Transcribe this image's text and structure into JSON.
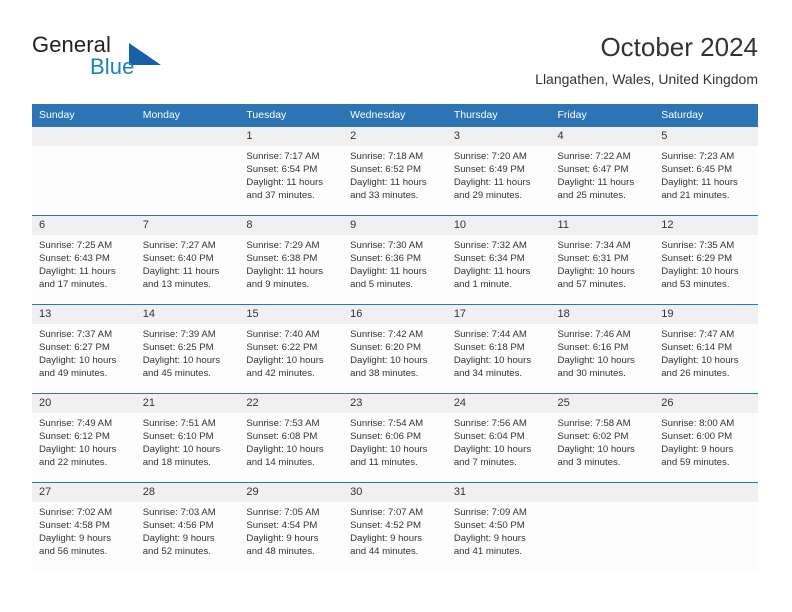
{
  "brand": {
    "name_top": "General",
    "name_bottom": "Blue",
    "logo_icon": "triangle-logo-icon",
    "color_top": "#231f20",
    "color_bottom": "#1d80c4",
    "color_triangle": "#1560a8"
  },
  "header": {
    "title": "October 2024",
    "location": "Llangathen, Wales, United Kingdom"
  },
  "theme": {
    "header_blue": "#2c74b3",
    "daynum_gray": "#f0f0f0",
    "text": "#333333"
  },
  "calendar": {
    "weekday_headers": [
      "Sunday",
      "Monday",
      "Tuesday",
      "Wednesday",
      "Thursday",
      "Friday",
      "Saturday"
    ],
    "weeks": [
      [
        {
          "day": "",
          "empty": true
        },
        {
          "day": "",
          "empty": true
        },
        {
          "day": "1",
          "sunrise": "Sunrise: 7:17 AM",
          "sunset": "Sunset: 6:54 PM",
          "daylight": "Daylight: 11 hours and 37 minutes."
        },
        {
          "day": "2",
          "sunrise": "Sunrise: 7:18 AM",
          "sunset": "Sunset: 6:52 PM",
          "daylight": "Daylight: 11 hours and 33 minutes."
        },
        {
          "day": "3",
          "sunrise": "Sunrise: 7:20 AM",
          "sunset": "Sunset: 6:49 PM",
          "daylight": "Daylight: 11 hours and 29 minutes."
        },
        {
          "day": "4",
          "sunrise": "Sunrise: 7:22 AM",
          "sunset": "Sunset: 6:47 PM",
          "daylight": "Daylight: 11 hours and 25 minutes."
        },
        {
          "day": "5",
          "sunrise": "Sunrise: 7:23 AM",
          "sunset": "Sunset: 6:45 PM",
          "daylight": "Daylight: 11 hours and 21 minutes."
        }
      ],
      [
        {
          "day": "6",
          "sunrise": "Sunrise: 7:25 AM",
          "sunset": "Sunset: 6:43 PM",
          "daylight": "Daylight: 11 hours and 17 minutes."
        },
        {
          "day": "7",
          "sunrise": "Sunrise: 7:27 AM",
          "sunset": "Sunset: 6:40 PM",
          "daylight": "Daylight: 11 hours and 13 minutes."
        },
        {
          "day": "8",
          "sunrise": "Sunrise: 7:29 AM",
          "sunset": "Sunset: 6:38 PM",
          "daylight": "Daylight: 11 hours and 9 minutes."
        },
        {
          "day": "9",
          "sunrise": "Sunrise: 7:30 AM",
          "sunset": "Sunset: 6:36 PM",
          "daylight": "Daylight: 11 hours and 5 minutes."
        },
        {
          "day": "10",
          "sunrise": "Sunrise: 7:32 AM",
          "sunset": "Sunset: 6:34 PM",
          "daylight": "Daylight: 11 hours and 1 minute."
        },
        {
          "day": "11",
          "sunrise": "Sunrise: 7:34 AM",
          "sunset": "Sunset: 6:31 PM",
          "daylight": "Daylight: 10 hours and 57 minutes."
        },
        {
          "day": "12",
          "sunrise": "Sunrise: 7:35 AM",
          "sunset": "Sunset: 6:29 PM",
          "daylight": "Daylight: 10 hours and 53 minutes."
        }
      ],
      [
        {
          "day": "13",
          "sunrise": "Sunrise: 7:37 AM",
          "sunset": "Sunset: 6:27 PM",
          "daylight": "Daylight: 10 hours and 49 minutes."
        },
        {
          "day": "14",
          "sunrise": "Sunrise: 7:39 AM",
          "sunset": "Sunset: 6:25 PM",
          "daylight": "Daylight: 10 hours and 45 minutes."
        },
        {
          "day": "15",
          "sunrise": "Sunrise: 7:40 AM",
          "sunset": "Sunset: 6:22 PM",
          "daylight": "Daylight: 10 hours and 42 minutes."
        },
        {
          "day": "16",
          "sunrise": "Sunrise: 7:42 AM",
          "sunset": "Sunset: 6:20 PM",
          "daylight": "Daylight: 10 hours and 38 minutes."
        },
        {
          "day": "17",
          "sunrise": "Sunrise: 7:44 AM",
          "sunset": "Sunset: 6:18 PM",
          "daylight": "Daylight: 10 hours and 34 minutes."
        },
        {
          "day": "18",
          "sunrise": "Sunrise: 7:46 AM",
          "sunset": "Sunset: 6:16 PM",
          "daylight": "Daylight: 10 hours and 30 minutes."
        },
        {
          "day": "19",
          "sunrise": "Sunrise: 7:47 AM",
          "sunset": "Sunset: 6:14 PM",
          "daylight": "Daylight: 10 hours and 26 minutes."
        }
      ],
      [
        {
          "day": "20",
          "sunrise": "Sunrise: 7:49 AM",
          "sunset": "Sunset: 6:12 PM",
          "daylight": "Daylight: 10 hours and 22 minutes."
        },
        {
          "day": "21",
          "sunrise": "Sunrise: 7:51 AM",
          "sunset": "Sunset: 6:10 PM",
          "daylight": "Daylight: 10 hours and 18 minutes."
        },
        {
          "day": "22",
          "sunrise": "Sunrise: 7:53 AM",
          "sunset": "Sunset: 6:08 PM",
          "daylight": "Daylight: 10 hours and 14 minutes."
        },
        {
          "day": "23",
          "sunrise": "Sunrise: 7:54 AM",
          "sunset": "Sunset: 6:06 PM",
          "daylight": "Daylight: 10 hours and 11 minutes."
        },
        {
          "day": "24",
          "sunrise": "Sunrise: 7:56 AM",
          "sunset": "Sunset: 6:04 PM",
          "daylight": "Daylight: 10 hours and 7 minutes."
        },
        {
          "day": "25",
          "sunrise": "Sunrise: 7:58 AM",
          "sunset": "Sunset: 6:02 PM",
          "daylight": "Daylight: 10 hours and 3 minutes."
        },
        {
          "day": "26",
          "sunrise": "Sunrise: 8:00 AM",
          "sunset": "Sunset: 6:00 PM",
          "daylight": "Daylight: 9 hours and 59 minutes."
        }
      ],
      [
        {
          "day": "27",
          "sunrise": "Sunrise: 7:02 AM",
          "sunset": "Sunset: 4:58 PM",
          "daylight": "Daylight: 9 hours and 56 minutes."
        },
        {
          "day": "28",
          "sunrise": "Sunrise: 7:03 AM",
          "sunset": "Sunset: 4:56 PM",
          "daylight": "Daylight: 9 hours and 52 minutes."
        },
        {
          "day": "29",
          "sunrise": "Sunrise: 7:05 AM",
          "sunset": "Sunset: 4:54 PM",
          "daylight": "Daylight: 9 hours and 48 minutes."
        },
        {
          "day": "30",
          "sunrise": "Sunrise: 7:07 AM",
          "sunset": "Sunset: 4:52 PM",
          "daylight": "Daylight: 9 hours and 44 minutes."
        },
        {
          "day": "31",
          "sunrise": "Sunrise: 7:09 AM",
          "sunset": "Sunset: 4:50 PM",
          "daylight": "Daylight: 9 hours and 41 minutes."
        },
        {
          "day": "",
          "empty": true
        },
        {
          "day": "",
          "empty": true
        }
      ]
    ]
  }
}
